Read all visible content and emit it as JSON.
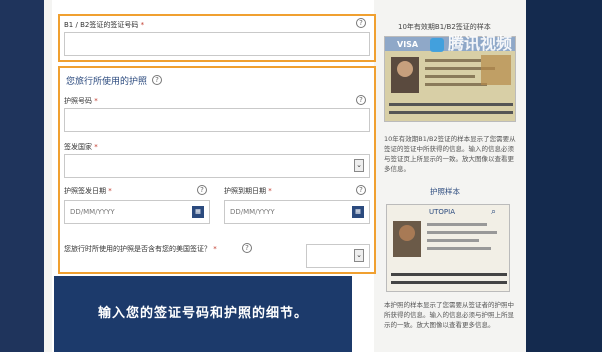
{
  "visa_section": {
    "label": "B1 / B2签证的签证号码",
    "required_mark": "*",
    "help": "?"
  },
  "passport_section": {
    "title": "您旅行所使用的护照",
    "help": "?",
    "passport_number": {
      "label": "护照号码",
      "required_mark": "*",
      "help": "?"
    },
    "issuing_country": {
      "label": "签发国家",
      "required_mark": "*",
      "dropdown_glyph": "⌄"
    },
    "issue_date": {
      "label": "护照签发日期",
      "required_mark": "*",
      "help": "?",
      "placeholder": "DD/MM/YYYY",
      "cal_glyph": "▦"
    },
    "expiry_date": {
      "label": "护照到期日期",
      "required_mark": "*",
      "help": "?",
      "placeholder": "DD/MM/YYYY",
      "cal_glyph": "▦"
    },
    "us_visa_question": {
      "label": "您旅行时所使用的护照是否含有您的美国签证？",
      "required_mark": "*",
      "help": "?",
      "dropdown_glyph": "⌄"
    }
  },
  "banner": {
    "text": "输入您的签证号码和护照的细节。"
  },
  "side": {
    "visa_sample_title": "10年有效期B1/B2签证的样本",
    "visa_sample_desc": "10年有效期B1/B2签证的样本显示了您需要从签证的签证中所获得的信息。输入的信息必须与签证页上所显示的一致。放大图像以查看更多信息。",
    "visa_card_word": "VISA",
    "passport_sample_title": "护照样本",
    "passport_sample_desc": "本护照的样本显示了您需要从签证者的护照中所获得的信息。输入的信息必须与护照上所显示的一致。放大图像以查看更多信息。",
    "passport_card_word": "UTOPIA"
  },
  "watermark": {
    "text": "腾讯视频"
  },
  "colors": {
    "highlight_border": "#f0a030",
    "brand_blue": "#2b4a7e",
    "banner_bg": "#1c3a6b",
    "backdrop": "#1d3157"
  }
}
